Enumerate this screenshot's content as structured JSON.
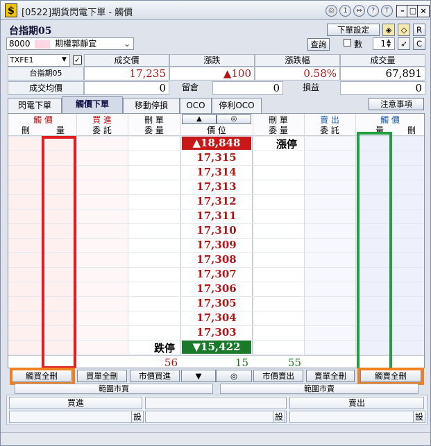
{
  "window": {
    "title": "[0522]期貨閃電下單 - 觸價",
    "titlebar_buttons": [
      "◎",
      "1",
      "⇔",
      "?",
      "T"
    ]
  },
  "header": {
    "instrument_name": "台指期05",
    "settings_button": "下單設定",
    "reset_button": "R",
    "account_number": "8000",
    "account_name": "期權郭靜宜",
    "query_button": "查詢",
    "qty_label": "數",
    "qty_value": "1",
    "c_button": "C"
  },
  "quote": {
    "symbol": "TXFE1",
    "labels": [
      "成交價",
      "漲跌",
      "漲跌幅",
      "成交量"
    ],
    "name": "台指期05",
    "last_price": "17,235",
    "change": "▲100",
    "change_pct": "0.58%",
    "volume": "67,891",
    "avg_label": "成交均價",
    "avg_value": "0",
    "position_label": "留倉",
    "position_value": "0",
    "pnl_label": "損益",
    "pnl_value": "0"
  },
  "tabs": [
    "閃電下單",
    "觸價下單",
    "移動停損",
    "OCO",
    "停利OCO"
  ],
  "notice_button": "注意事項",
  "grid": {
    "header_row1": [
      "觸 價",
      "買 進",
      "刪 單",
      "▲",
      "◎",
      "刪 單",
      "賣 出",
      "觸 價"
    ],
    "header_row2": [
      "刪",
      "量",
      "委 託",
      "委 量",
      "價 位",
      "委 量",
      "委 託",
      "量",
      "刪"
    ],
    "limit_up_label": "漲停",
    "limit_up_price": "▲18,848",
    "prices": [
      "17,315",
      "17,314",
      "17,313",
      "17,312",
      "17,311",
      "17,310",
      "17,309",
      "17,308",
      "17,307",
      "17,306",
      "17,305",
      "17,304",
      "17,303"
    ],
    "limit_down_label": "跌停",
    "limit_down_price": "▼15,422",
    "total_buy": "56",
    "total_center": "15",
    "total_sell": "55"
  },
  "bottom_buttons": [
    "觸買全刪",
    "買單全刪",
    "市價買進",
    "▼",
    "◎",
    "市價賣出",
    "賣單全刪",
    "觸賣全刪"
  ],
  "range_buy": "範圍市買",
  "range_sell": "範圍市賣",
  "buy_label": "買進",
  "sell_label": "賣出",
  "set_label": "設",
  "colors": {
    "buy_red": "#b01818",
    "sell_green": "#1a7a1a",
    "limit_up_bg": "#c81818",
    "limit_down_bg": "#1a7a2a",
    "highlight_red": "#e02020",
    "highlight_green": "#20a040",
    "highlight_orange": "#f08020"
  }
}
